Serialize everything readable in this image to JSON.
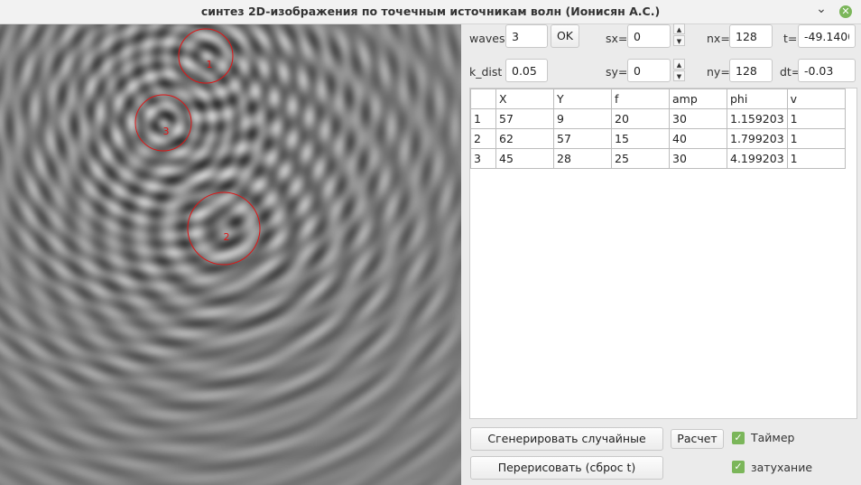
{
  "window": {
    "title": "синтез 2D-изображения по точечным источникам волн (Ионисян А.С.)",
    "min_icon": "minimize-icon",
    "close_icon": "close-icon"
  },
  "controls": {
    "waves_label": "waves",
    "waves_value": "3",
    "ok_label": "OK",
    "sx_label": "sx=",
    "sx_value": "0",
    "sy_label": "sy=",
    "sy_value": "0",
    "nx_label": "nx=",
    "nx_value": "128",
    "ny_label": "ny=",
    "ny_value": "128",
    "t_label": "t=",
    "t_value": "-49.1400",
    "dt_label": "dt=",
    "dt_value": "-0.03",
    "k_dist_label": "k_dist",
    "k_dist_value": "0.05"
  },
  "table": {
    "headers": [
      "X",
      "Y",
      "f",
      "amp",
      "phi",
      "v"
    ],
    "rows": [
      {
        "num": "1",
        "cells": [
          "57",
          "9",
          "20",
          "30",
          "1.159203",
          "1"
        ]
      },
      {
        "num": "2",
        "cells": [
          "62",
          "57",
          "15",
          "40",
          "1.799203",
          "1"
        ]
      },
      {
        "num": "3",
        "cells": [
          "45",
          "28",
          "25",
          "30",
          "4.199203",
          "1"
        ]
      }
    ]
  },
  "buttons": {
    "generate": "Сгенерировать случайные",
    "calc": "Расчет",
    "redraw": "Перерисовать (сброс t)"
  },
  "checks": {
    "timer": "Таймер",
    "damping": "затухание"
  },
  "sources": [
    {
      "label": "1",
      "x": 57,
      "y": 9,
      "f": 20
    },
    {
      "label": "2",
      "x": 62,
      "y": 57,
      "f": 15
    },
    {
      "label": "3",
      "x": 45,
      "y": 28,
      "f": 25
    }
  ],
  "colors": {
    "marker": "#e01515",
    "check": "#7bb65a"
  }
}
